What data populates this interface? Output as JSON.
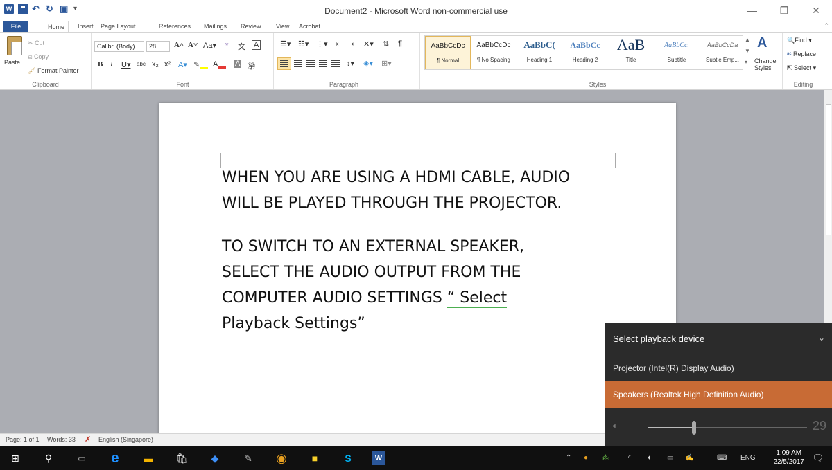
{
  "window": {
    "title": "Document2 - Microsoft Word non-commercial use",
    "minimize": "—",
    "restore": "❐",
    "close": "✕"
  },
  "tabs": [
    "File",
    "Home",
    "Insert",
    "Page Layout",
    "References",
    "Mailings",
    "Review",
    "View",
    "Acrobat"
  ],
  "ribbon": {
    "clipboard": {
      "paste": "Paste",
      "cut": "Cut",
      "copy": "Copy",
      "format_painter": "Format Painter",
      "label": "Clipboard"
    },
    "font": {
      "name": "Calibri (Body)",
      "size": "28",
      "label": "Font"
    },
    "paragraph": {
      "label": "Paragraph"
    },
    "styles": {
      "label": "Styles",
      "items": [
        {
          "sample": "AaBbCcDc",
          "name": "¶ Normal"
        },
        {
          "sample": "AaBbCcDc",
          "name": "¶ No Spacing"
        },
        {
          "sample": "AaBbC(",
          "name": "Heading 1"
        },
        {
          "sample": "AaBbCc",
          "name": "Heading 2"
        },
        {
          "sample": "AaB",
          "name": "Title"
        },
        {
          "sample": "AaBbCc.",
          "name": "Subtitle"
        },
        {
          "sample": "AaBbCcDa",
          "name": "Subtle Emp..."
        }
      ],
      "change_styles": "Change Styles"
    },
    "editing": {
      "find": "Find",
      "replace": "Replace",
      "select": "Select",
      "label": "Editing"
    }
  },
  "document": {
    "para1": [
      "WHEN YOU ARE USING A HDMI CABLE, AUDIO",
      "WILL BE PLAYED THROUGH THE PROJECTOR."
    ],
    "para2_lines": [
      "TO SWITCH TO AN EXTERNAL SPEAKER,",
      "SELECT THE AUDIO OUTPUT FROM THE"
    ],
    "para2_line3_main": "COMPUTER AUDIO SETTINGS ",
    "para2_line3_quote": "“ Select",
    "para2_line4": "Playback Settings”"
  },
  "status": {
    "page": "Page: 1 of 1",
    "words": "Words: 33",
    "language": "English (Singapore)"
  },
  "playback_popup": {
    "header": "Select playback device",
    "devices": [
      "Projector (Intel(R) Display Audio)",
      "Speakers (Realtek High Definition Audio)"
    ],
    "selected_device": "Speakers (Realtek High Definition Audio)",
    "volume": "29",
    "volume_fraction": 0.29
  },
  "taskbar": {
    "lang": "ENG",
    "time": "1:09 AM",
    "date": "22/5/2017"
  },
  "colors": {
    "word_blue": "#2b579a",
    "selected_device_bg": "#c86b35",
    "popup_bg": "#2b2b2b"
  }
}
